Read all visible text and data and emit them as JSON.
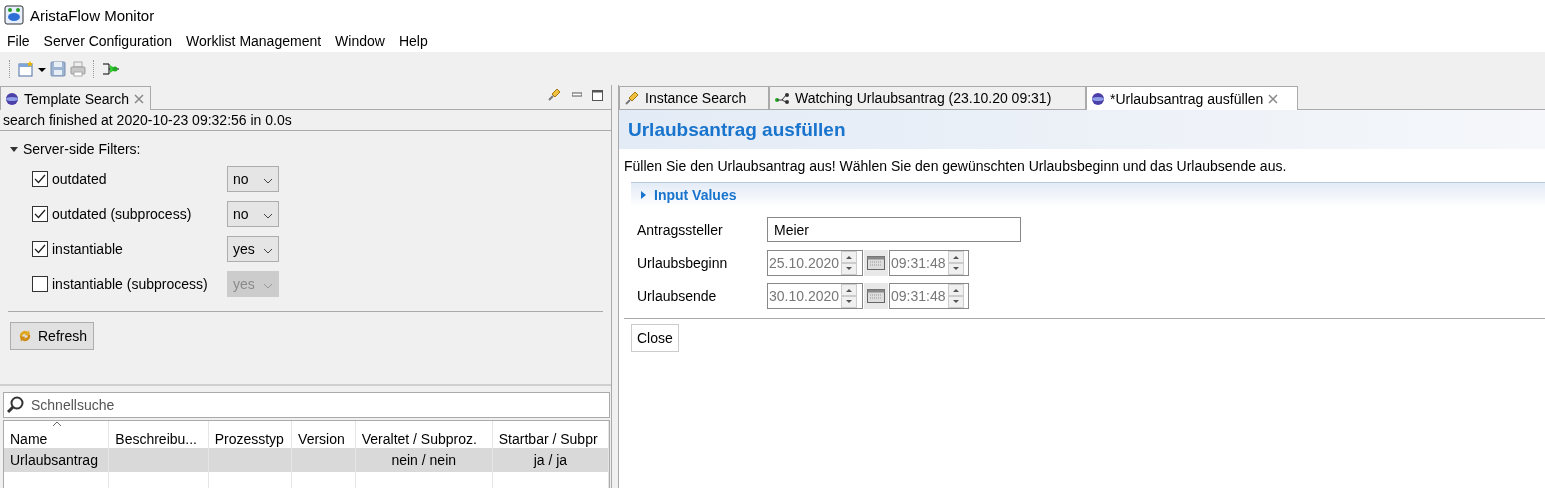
{
  "window": {
    "title": "AristaFlow Monitor"
  },
  "menu": [
    "File",
    "Server Configuration",
    "Worklist Management",
    "Window",
    "Help"
  ],
  "left_view": {
    "tab": {
      "label": "Template Search",
      "selected": true
    },
    "status": "search finished at 2020-10-23 09:32:56 in 0.0s",
    "filters": {
      "label": "Server-side Filters:",
      "expanded": true,
      "items": [
        {
          "label": "outdated",
          "checked": true,
          "value": "no",
          "disabled": false
        },
        {
          "label": "outdated (subprocess)",
          "checked": true,
          "value": "no",
          "disabled": false
        },
        {
          "label": "instantiable",
          "checked": true,
          "value": "yes",
          "disabled": false
        },
        {
          "label": "instantiable (subprocess)",
          "checked": false,
          "value": "yes",
          "disabled": true
        }
      ]
    },
    "refresh_button": "Refresh",
    "search": {
      "placeholder": "Schnellsuche"
    },
    "table": {
      "columns": [
        "Name",
        "Beschreibu...",
        "Prozesstyp",
        "Version",
        "Veraltet / Subproz.",
        "Startbar / Subpr"
      ],
      "rows": [
        {
          "selected": true,
          "cells": [
            "Urlaubsantrag",
            null,
            null,
            null,
            "nein / nein",
            "ja / ja"
          ]
        }
      ]
    }
  },
  "right_view": {
    "tabs": [
      {
        "kind": "search",
        "label": "Instance Search",
        "selected": false
      },
      {
        "kind": "watch",
        "label": "Watching Urlaubsantrag (23.10.20 09:31)",
        "selected": false
      },
      {
        "kind": "form",
        "label": "*Urlaubsantrag ausfüllen",
        "selected": true
      }
    ],
    "form": {
      "title": "Urlaubsantrag ausfüllen",
      "description": "Füllen Sie den Urlaubsantrag aus! Wählen Sie den gewünschten Urlaubsbeginn und das Urlaubsende aus.",
      "section": {
        "label": "Input Values",
        "expanded": false
      },
      "fields": [
        {
          "kind": "text",
          "label": "Antragssteller",
          "value": "Meier"
        },
        {
          "kind": "datetime",
          "label": "Urlaubsbeginn",
          "date": "25.10.2020",
          "time": "09:31:48"
        },
        {
          "kind": "datetime",
          "label": "Urlaubsende",
          "date": "30.10.2020",
          "time": "09:31:48"
        }
      ],
      "close_button": "Close"
    }
  }
}
